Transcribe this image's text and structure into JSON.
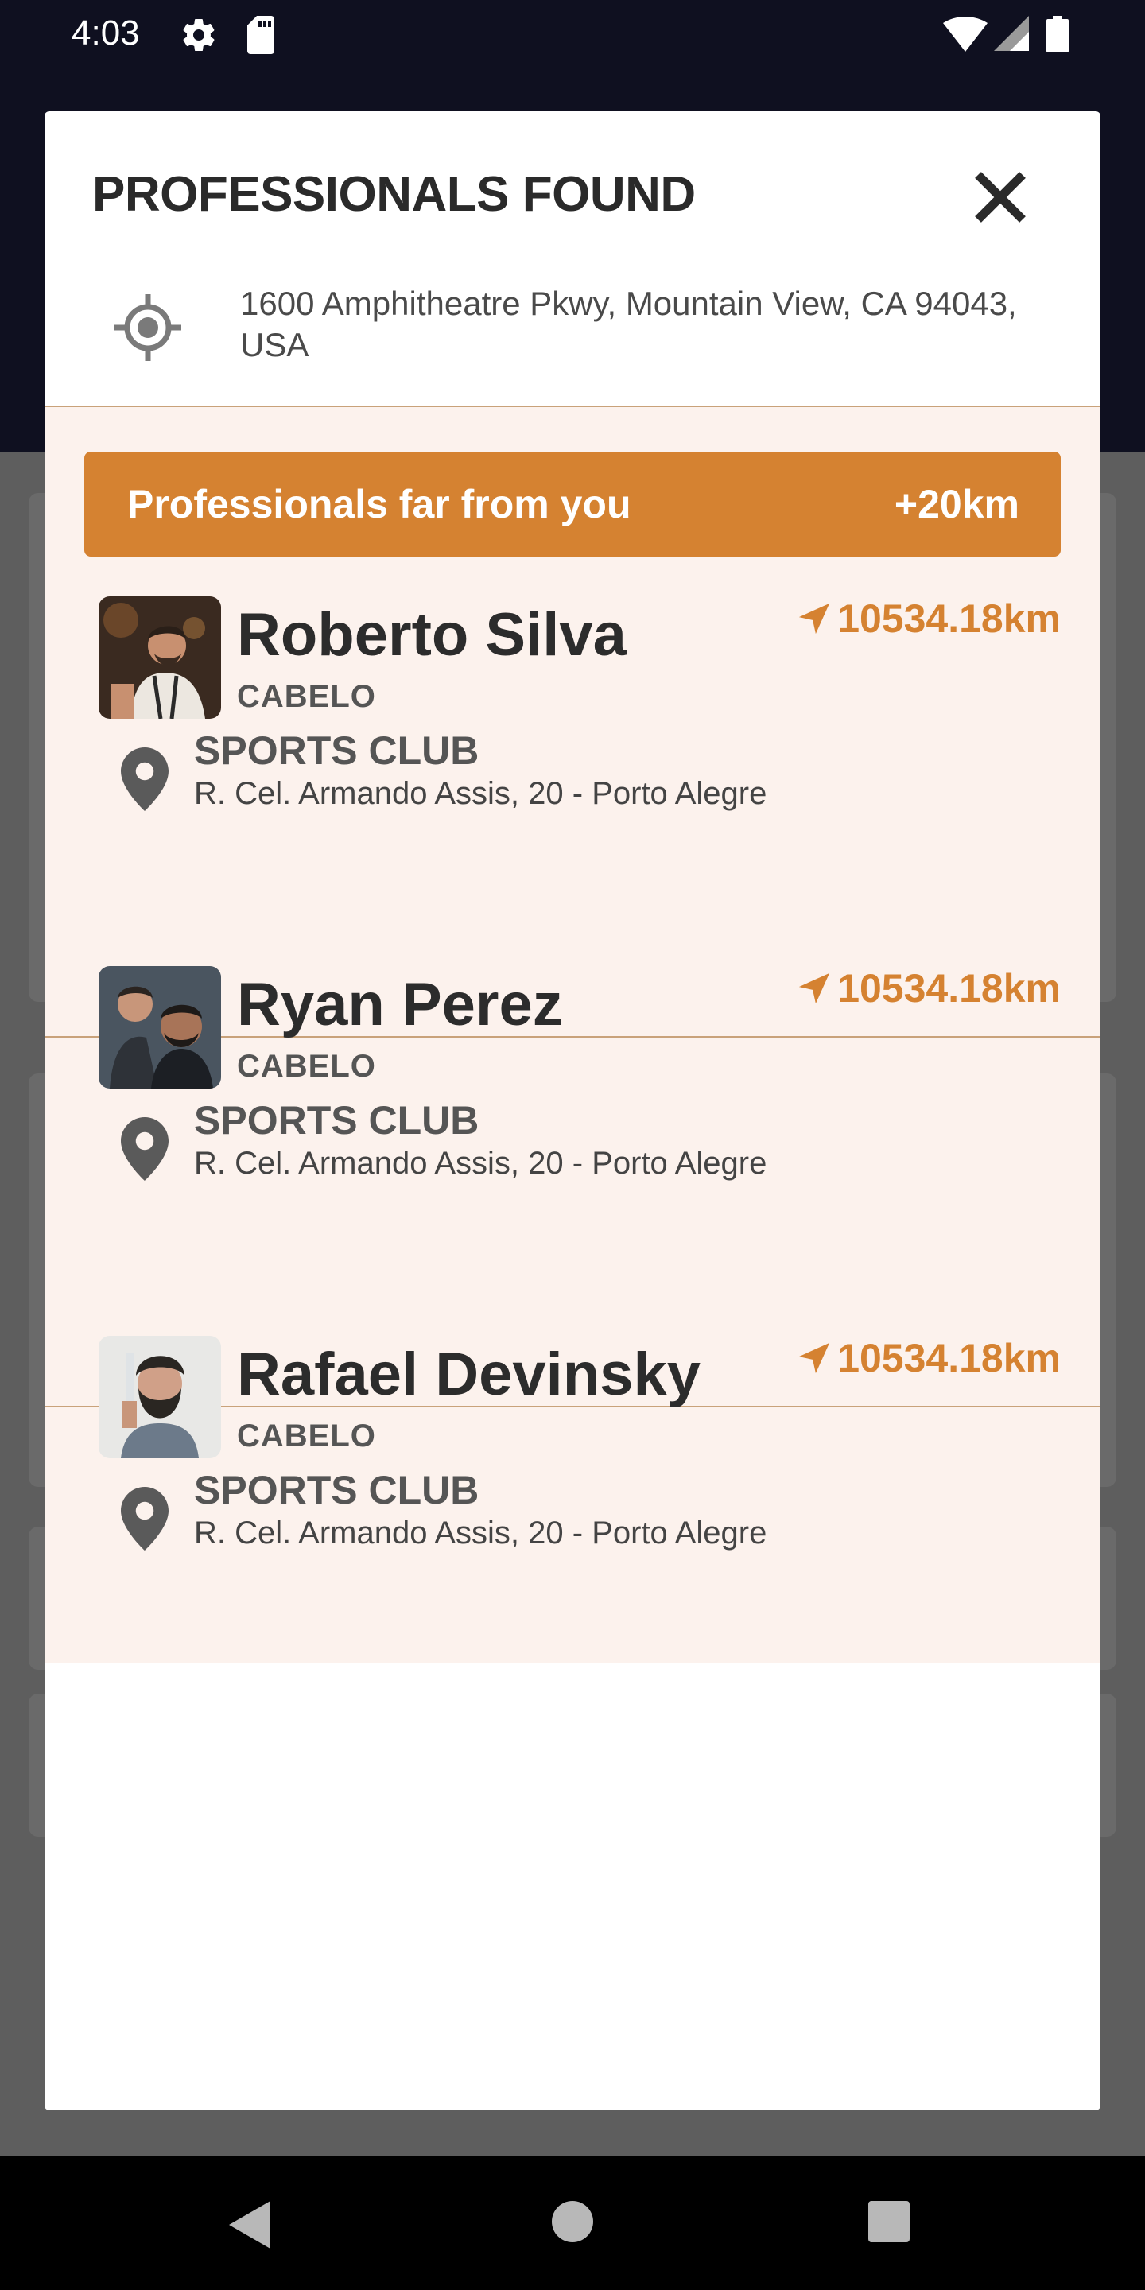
{
  "status_bar": {
    "time": "4:03",
    "icons": [
      "gear-icon",
      "sd-card-icon",
      "wifi-icon",
      "signal-icon",
      "battery-icon"
    ]
  },
  "modal": {
    "title": "PROFESSIONALS FOUND",
    "close_icon": "close-icon",
    "address": "1600 Amphitheatre Pkwy, Mountain View, CA 94043, USA",
    "banner": {
      "label": "Professionals far from you",
      "distance": "+20km"
    },
    "professionals": [
      {
        "name": "Roberto Silva",
        "role": "CABELO",
        "distance": "10534.18km",
        "club": "SPORTS CLUB",
        "club_address": "R. Cel. Armando Assis, 20 - Porto Alegre"
      },
      {
        "name": "Ryan Perez",
        "role": "CABELO",
        "distance": "10534.18km",
        "club": "SPORTS CLUB",
        "club_address": "R. Cel. Armando Assis, 20 - Porto Alegre"
      },
      {
        "name": "Rafael Devinsky",
        "role": "CABELO",
        "distance": "10534.18km",
        "club": "SPORTS CLUB",
        "club_address": "R. Cel. Armando Assis, 20 - Porto Alegre"
      }
    ]
  },
  "colors": {
    "accent": "#d58231",
    "list_background": "#fcf2ed",
    "header_background": "#0f1020"
  },
  "nav_bar": {
    "icons": [
      "back-icon",
      "home-icon",
      "recents-icon"
    ]
  }
}
